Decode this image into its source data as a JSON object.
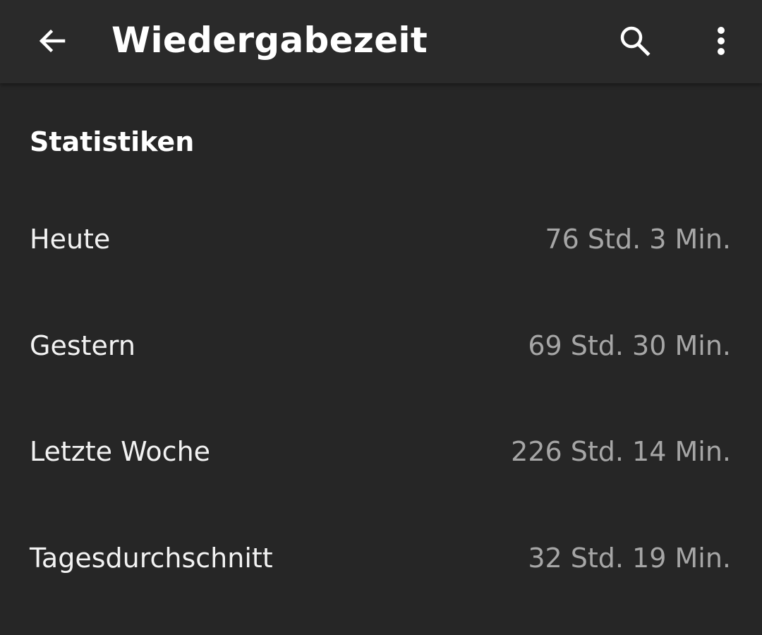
{
  "app_bar": {
    "title": "Wiedergabezeit",
    "back_icon": "arrow-back-icon",
    "search_icon": "search-icon",
    "menu_icon": "more-vert-icon"
  },
  "colors": {
    "background": "#262626",
    "app_bar": "#2a2a2a",
    "primary_text": "#ffffff",
    "secondary_text": "#a6a6a6"
  },
  "section": {
    "header": "Statistiken"
  },
  "stats": [
    {
      "label": "Heute",
      "value": "76 Std. 3 Min."
    },
    {
      "label": "Gestern",
      "value": "69 Std. 30 Min."
    },
    {
      "label": "Letzte Woche",
      "value": "226 Std. 14 Min."
    },
    {
      "label": "Tagesdurchschnitt",
      "value": "32 Std. 19 Min."
    }
  ]
}
